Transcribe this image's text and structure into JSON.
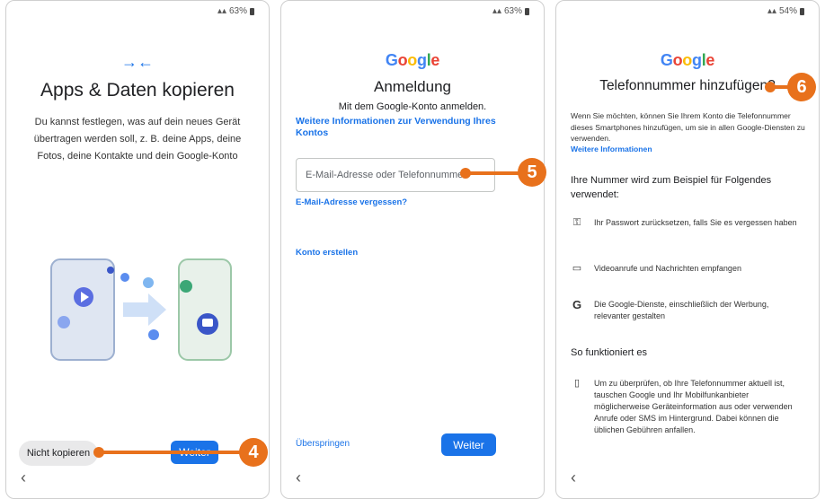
{
  "screen1": {
    "status": "63%",
    "title": "Apps & Daten kopieren",
    "description": "Du kannst festlegen, was auf dein neues Gerät übertragen werden soll, z. B. deine Apps, deine Fotos, deine Kontakte und dein Google-Konto",
    "skip_button": "Nicht kopieren",
    "next_button": "Weiter",
    "callout": "4"
  },
  "screen2": {
    "status": "63%",
    "logo": [
      "G",
      "o",
      "o",
      "g",
      "l",
      "e"
    ],
    "title": "Anmeldung",
    "subtitle": "Mit dem Google-Konto anmelden.",
    "info_link": "Weitere Informationen zur Verwendung Ihres Kontos",
    "email_placeholder": "E-Mail-Adresse oder Telefonnummer",
    "forgot_link": "E-Mail-Adresse vergessen?",
    "create_link": "Konto erstellen",
    "skip_link": "Überspringen",
    "next_button": "Weiter",
    "callout": "5"
  },
  "screen3": {
    "status": "54%",
    "logo": [
      "G",
      "o",
      "o",
      "g",
      "l",
      "e"
    ],
    "title": "Telefonnummer hinzufügen?",
    "intro": "Wenn Sie möchten, können Sie Ihrem Konto die Telefonnummer dieses Smartphones hinzufügen, um sie in allen Google-Diensten zu verwenden.",
    "more_link": "Weitere Informationen",
    "usage_heading": "Ihre Nummer wird zum Beispiel für Folgendes verwendet:",
    "features": [
      {
        "icon": "key-icon",
        "text": "Ihr Passwort zurücksetzen, falls Sie es vergessen haben"
      },
      {
        "icon": "video-icon",
        "text": "Videoanrufe und Nachrichten empfangen"
      },
      {
        "icon": "google-g-icon",
        "text": "Die Google-Dienste, einschließlich der Werbung, relevanter gestalten"
      }
    ],
    "how_heading": "So funktioniert es",
    "how_text": "Um zu überprüfen, ob Ihre Telefonnummer aktuell ist, tauschen Google und Ihr Mobilfunkanbieter möglicherweise Geräteinformation aus oder verwenden Anrufe oder SMS im Hintergrund. Dabei können die üblichen Gebühren anfallen.",
    "callout": "6"
  },
  "colors": {
    "accent": "#1a73e8",
    "callout": "#e8711c"
  }
}
